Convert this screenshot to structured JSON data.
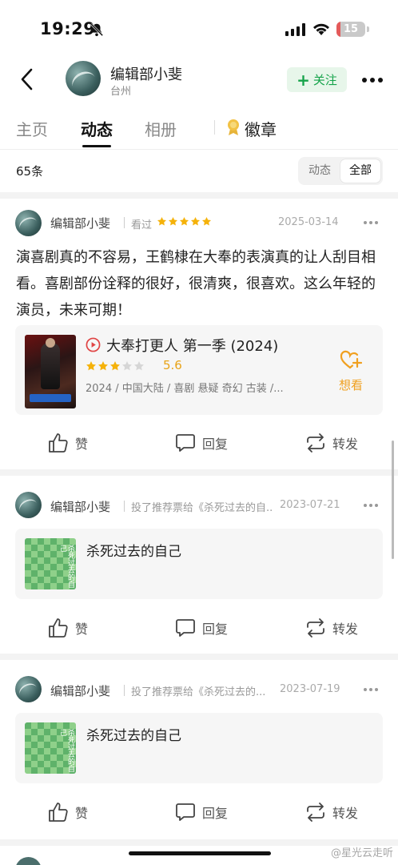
{
  "status_bar": {
    "time": "19:29",
    "battery": "15",
    "battery_level": 0.15
  },
  "header": {
    "name": "编辑部小斐",
    "location": "台州",
    "follow_label": "关注"
  },
  "tabs": [
    {
      "label": "主页",
      "active": false
    },
    {
      "label": "动态",
      "active": true
    },
    {
      "label": "相册",
      "active": false
    },
    {
      "label": "徽章",
      "active": false
    }
  ],
  "filter": {
    "count": "65条",
    "options": [
      "动态",
      "全部"
    ],
    "selected": "全部"
  },
  "posts": [
    {
      "name": "编辑部小斐",
      "action": "看过",
      "rating_stars": 5,
      "date": "2025-03-14",
      "text": "演喜剧真的不容易，王鹤棣在大奉的表演真的让人刮目相看。喜剧部份诠释的很好，很清爽，很喜欢。这么年轻的演员，未来可期！",
      "card": {
        "title": "大奉打更人 第一季 (2024)",
        "score": "5.6",
        "score_stars": 3,
        "meta": "2024 / 中国大陆 / 喜剧 悬疑 奇幻 古装 /...",
        "want_label": "想看"
      },
      "actions": {
        "like": "赞",
        "comment": "回复",
        "share": "转发"
      }
    },
    {
      "name": "编辑部小斐",
      "action": "投了推荐票给《杀死过去的自..",
      "date": "2023-07-21",
      "card": {
        "title": "杀死过去的自己",
        "cover_text": "杀死过去的自己"
      },
      "actions": {
        "like": "赞",
        "comment": "回复",
        "share": "转发"
      }
    },
    {
      "name": "编辑部小斐",
      "action": "投了推荐票给《杀死过去的...",
      "date": "2023-07-19",
      "card": {
        "title": "杀死过去的自己",
        "cover_text": "杀死过去的自己"
      },
      "actions": {
        "like": "赞",
        "comment": "回复",
        "share": "转发"
      }
    }
  ],
  "watermark": "@星光云走听",
  "colors": {
    "accent_green": "#15a34a",
    "star_gold": "#f5b20a",
    "want_orange": "#f0a020"
  }
}
